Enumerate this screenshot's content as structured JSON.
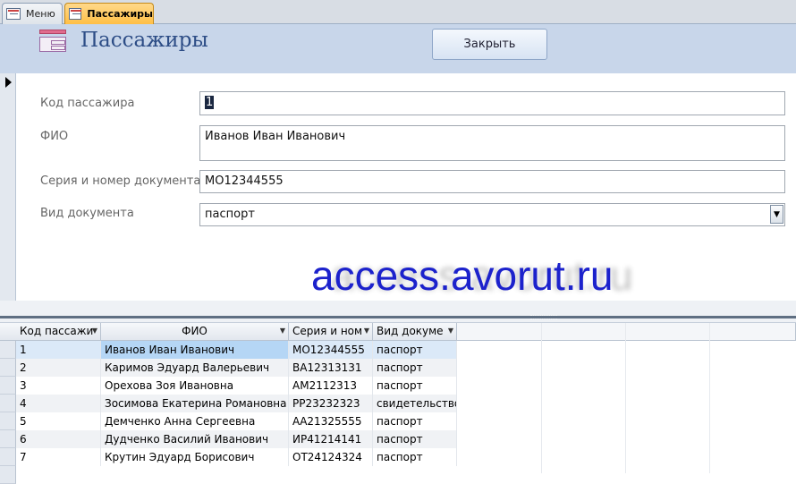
{
  "tabs": [
    {
      "label": "Меню",
      "active": false
    },
    {
      "label": "Пассажиры",
      "active": true
    }
  ],
  "form": {
    "title": "Пассажиры",
    "close_label": "Закрыть",
    "fields": {
      "id_label": "Код пассажира",
      "id_value": "1",
      "fio_label": "ФИО",
      "fio_value": "Иванов Иван Иванович",
      "doc_number_label": "Серия и номер документа",
      "doc_number_value": "МО12344555",
      "doc_type_label": "Вид документа",
      "doc_type_value": "паспорт"
    }
  },
  "watermark": "access.avorut.ru",
  "datasheet": {
    "columns": [
      "Код пассажи",
      "ФИО",
      "Серия и ном",
      "Вид докуме"
    ],
    "rows": [
      [
        "1",
        "Иванов Иван Иванович",
        "МО12344555",
        "паспорт"
      ],
      [
        "2",
        "Каримов Эдуард Валерьевич",
        "ВА12313131",
        "паспорт"
      ],
      [
        "3",
        "Орехова Зоя Ивановна",
        "АМ2112313",
        "паспорт"
      ],
      [
        "4",
        "Зосимова Екатерина Романовна",
        "РР23232323",
        "свидетельство"
      ],
      [
        "5",
        "Демченко Анна Сергеевна",
        "АА21325555",
        "паспорт"
      ],
      [
        "6",
        "Дудченко Василий Иванович",
        "ИР41214141",
        "паспорт"
      ],
      [
        "7",
        "Крутин Эдуард Борисович",
        "ОТ24124324",
        "паспорт"
      ]
    ],
    "selected_row": 0
  },
  "colors": {
    "header_bg": "#c8d6ea",
    "title": "#2d4d86",
    "active_tab": "#ffbf46",
    "selection": "#b5d6f5",
    "watermark": "#1c22cc"
  }
}
